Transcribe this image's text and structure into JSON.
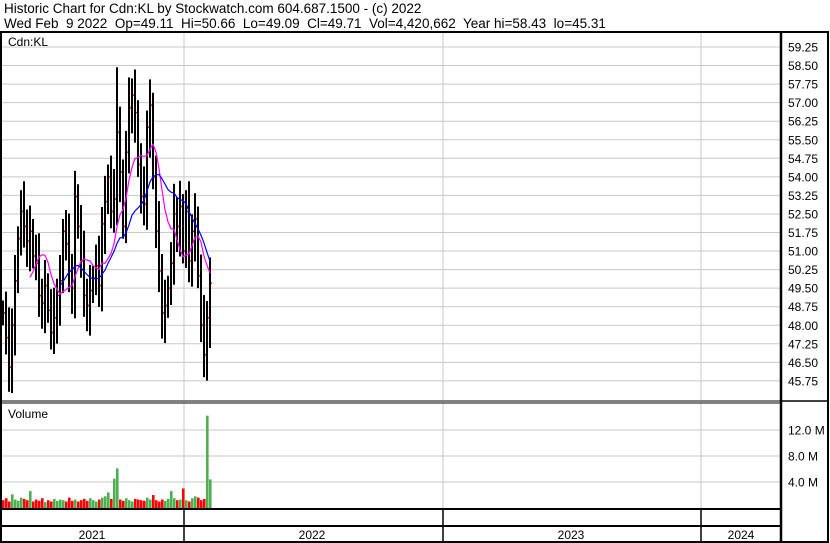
{
  "header": {
    "line1": "Historic Chart for Cdn:KL by Stockwatch.com 604.687.1500 - (c) 2022",
    "line2": "Wed Feb  9 2022  Op=49.11  Hi=50.66  Lo=49.09  Cl=49.71  Vol=4,420,662  Year hi=58.43  lo=45.31"
  },
  "colors": {
    "price": "#000000",
    "close_tick": "#ff0000",
    "ma_short": "#ff00ff",
    "ma_long": "#0000ff",
    "vol_up": "#4caf50",
    "vol_down": "#ff0000",
    "grid": "#c8c8c8"
  },
  "chart_data": [
    {
      "type": "ohlc",
      "title": "Cdn:KL",
      "ylim": [
        45.4,
        59.6
      ],
      "yticks": [
        "59.25",
        "58.50",
        "57.75",
        "57.00",
        "56.25",
        "55.50",
        "54.75",
        "54.00",
        "53.25",
        "52.50",
        "51.75",
        "51.00",
        "50.25",
        "49.50",
        "48.75",
        "48.00",
        "47.25",
        "46.50",
        "45.75"
      ],
      "xticks": [
        "2021",
        "2022",
        "2023",
        "2024"
      ],
      "closes": [
        48.5,
        47.5,
        46.3,
        48,
        49.8,
        51.5,
        52.6,
        52.0,
        51.4,
        51.8,
        50.8,
        50.5,
        49.2,
        48.9,
        49.6,
        48.6,
        47.7,
        48.3,
        49.2,
        49.8,
        51.8,
        51.3,
        50.2,
        49.5,
        53.2,
        52.0,
        50.6,
        49.2,
        48.8,
        49.4,
        49.9,
        50.4,
        49.6,
        52.1,
        53.0,
        54.0,
        52.6,
        53.1,
        55.8,
        54.2,
        52.0,
        55.0,
        56.8,
        57.3,
        56.6,
        54.5,
        53.2,
        52.9,
        56.0,
        56.9,
        54.0,
        51.8,
        50.2,
        48.5,
        48.8,
        49.5,
        50.5,
        52.5,
        52.0,
        52.8,
        51.0,
        52.6,
        50.6,
        51.8,
        52.3,
        50.0,
        48.0,
        46.8,
        48.3,
        49.7
      ],
      "year_high": 58.43,
      "year_low": 45.31,
      "ma_short_period": 10,
      "ma_long_period": 20
    },
    {
      "type": "bar",
      "title": "Volume",
      "ylim": [
        0,
        16
      ],
      "unit": "M",
      "yticks": [
        "12.0 M",
        "8.0 M",
        "4.0 M"
      ],
      "values": [
        1.2,
        1.5,
        1.0,
        2.1,
        1.3,
        1.1,
        1.6,
        1.4,
        1.2,
        2.6,
        1.0,
        1.3,
        1.1,
        1.5,
        0.9,
        1.2,
        1.0,
        1.4,
        1.1,
        1.3,
        1.2,
        1.0,
        1.6,
        1.1,
        1.3,
        1.0,
        1.2,
        1.4,
        1.1,
        1.5,
        1.2,
        1.0,
        1.3,
        1.6,
        1.8,
        2.4,
        1.4,
        4.5,
        6.1,
        1.3,
        1.1,
        1.5,
        1.2,
        1.0,
        1.4,
        1.3,
        1.2,
        1.1,
        1.6,
        1.3,
        2.0,
        1.2,
        1.0,
        1.3,
        1.1,
        1.4,
        2.6,
        1.5,
        1.2,
        1.3,
        3.0,
        1.2,
        1.0,
        1.5,
        1.8,
        1.6,
        1.2,
        1.4,
        14.2,
        4.4
      ]
    }
  ]
}
